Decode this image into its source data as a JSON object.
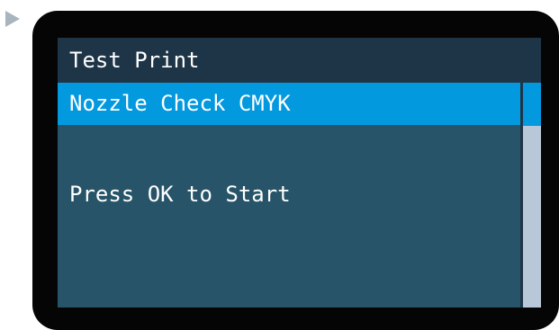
{
  "screen": {
    "title": "Test Print",
    "selected_item": "Nozzle Check CMYK",
    "message": "Press OK to Start"
  },
  "scrollbar": {
    "position_fraction": 0.0
  },
  "icons": {
    "indicator": "triangle-right-icon"
  },
  "colors": {
    "bezel": "#050505",
    "title_bar": "#1e3548",
    "screen_background": "#275468",
    "selection_highlight": "#0399df",
    "scroll_track": "#b8c8d8",
    "indicator": "#a8b4be",
    "text": "#ffffff"
  }
}
